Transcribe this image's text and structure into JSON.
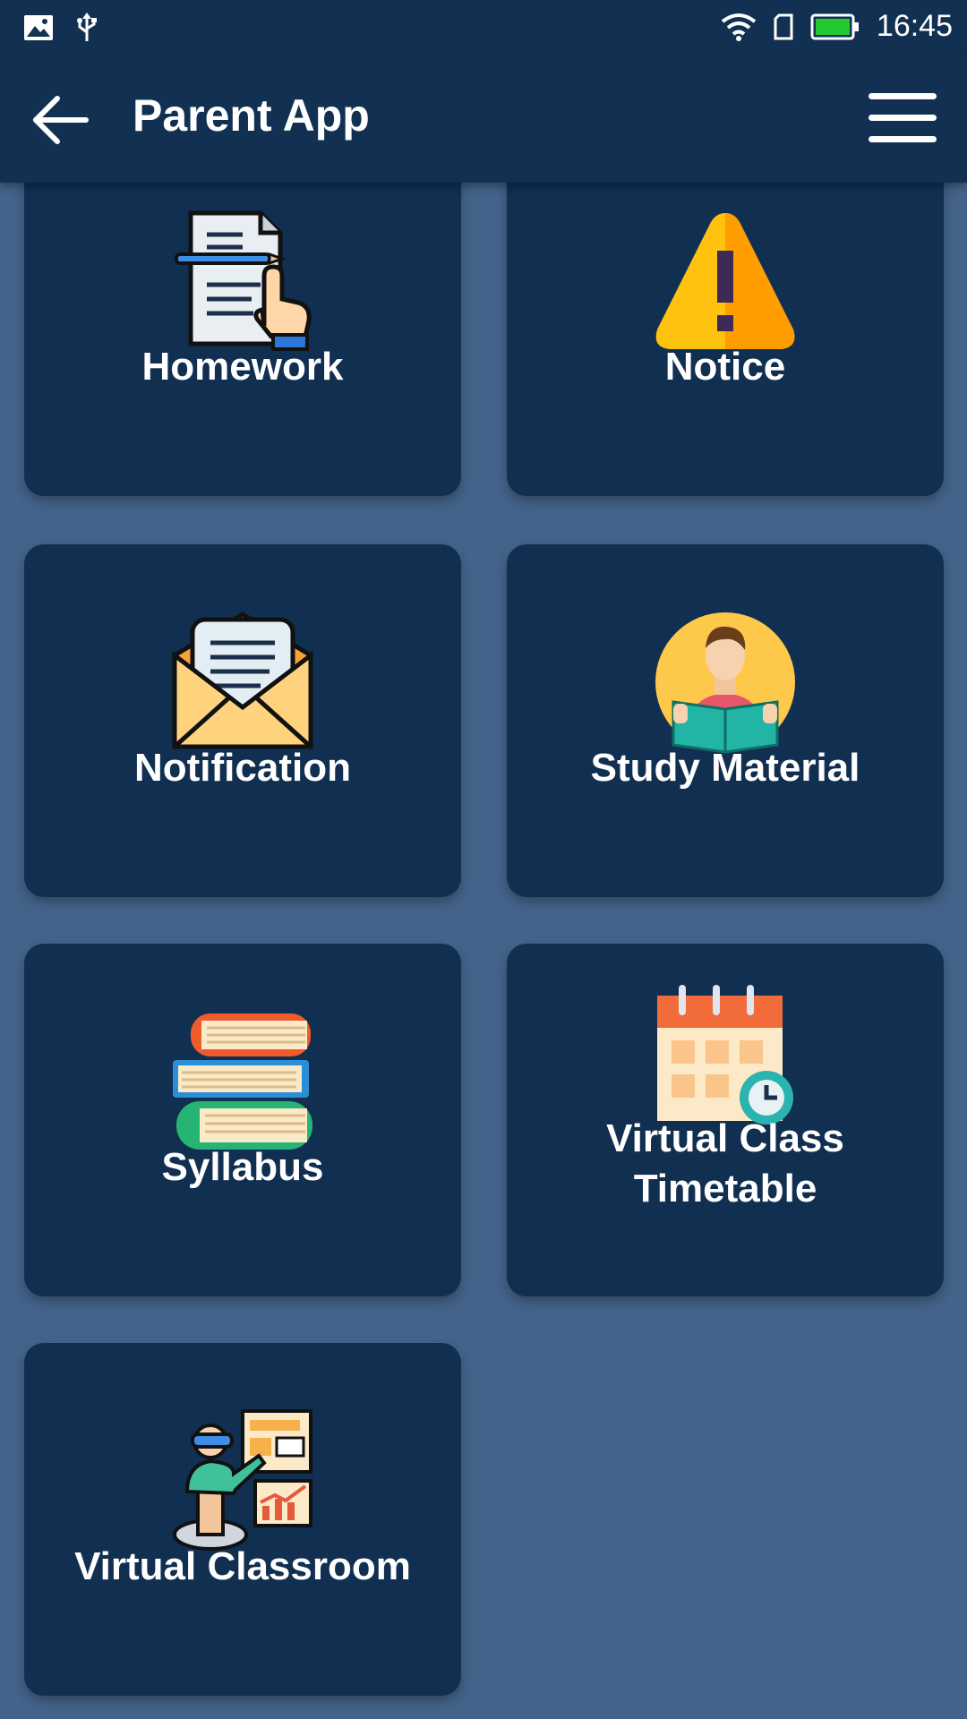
{
  "status_bar": {
    "time": "16:45"
  },
  "app_bar": {
    "title": "Parent App"
  },
  "tiles": [
    {
      "label": "Homework",
      "icon": "homework-icon"
    },
    {
      "label": "Notice",
      "icon": "warning-icon"
    },
    {
      "label": "Notification",
      "icon": "envelope-icon"
    },
    {
      "label": "Study Material",
      "icon": "student-reading-icon"
    },
    {
      "label": "Syllabus",
      "icon": "books-stack-icon"
    },
    {
      "label_line1": "Virtual Class",
      "label_line2": "Timetable",
      "icon": "calendar-clock-icon"
    },
    {
      "label": "Virtual Classroom",
      "icon": "vr-teacher-icon"
    }
  ],
  "colors": {
    "background": "#44638a",
    "bar": "#123152",
    "card": "#112f51",
    "text": "#ffffff"
  }
}
